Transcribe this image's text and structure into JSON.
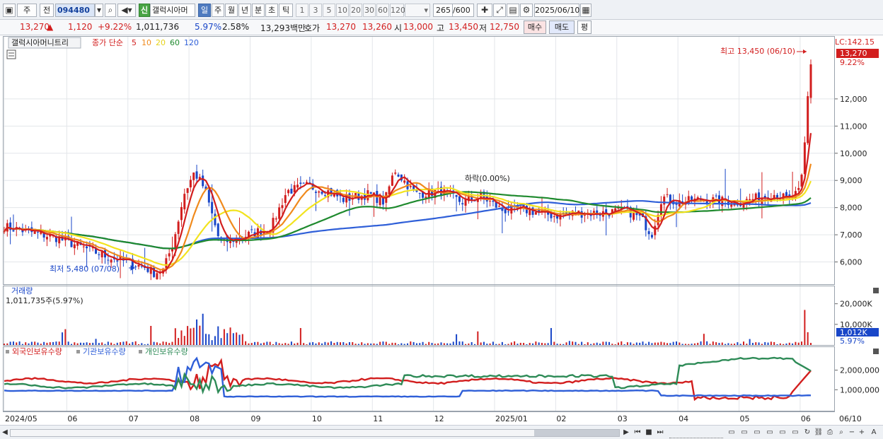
{
  "toolbar": {
    "market": "주",
    "prev": "전",
    "code": "094480",
    "new_badge": "신",
    "name": "갤럭시아머",
    "periods": [
      "일",
      "주",
      "월",
      "년",
      "분",
      "초",
      "틱"
    ],
    "active_period": "일",
    "intervals": [
      "1",
      "3",
      "5",
      "10",
      "20",
      "30",
      "60",
      "120"
    ],
    "count": "265",
    "count_max": "/600",
    "date": "2025/06/10"
  },
  "quote": {
    "price": "13,270",
    "arrow": "▲",
    "change": "1,120",
    "change_pct": "+9.22%",
    "volume": "1,011,736",
    "turnover_pct": "5.97%",
    "turnover2": "2.58%",
    "amount": "13,293백만",
    "bid_label": "호가",
    "ask": "13,270",
    "bid": "13,260",
    "open_label": "시",
    "open": "13,000",
    "high_label": "고",
    "high": "13,450",
    "low_label": "저",
    "low": "12,750",
    "buy_label": "매수",
    "sell_label": "매도",
    "eval_label": "평"
  },
  "legend": {
    "title": "갤럭시아머니트리",
    "ma_label": "종가 단순",
    "ma_periods": [
      "5",
      "10",
      "20",
      "60",
      "120"
    ]
  },
  "annotations": {
    "lc": "LC:142.15",
    "last_price": "13,270",
    "last_pct": "9.22%",
    "high_note": "최고 13,450 (06/10)",
    "low_note": "최저 5,480 (07/08)",
    "drop_note": "하락(0.00%)"
  },
  "volume_panel": {
    "title": "거래량",
    "value": "1,011,735주(5.97%)",
    "last_value": "1,012K",
    "last_pct": "5.97%"
  },
  "holding_panel": {
    "legend": [
      "외국인보유수량",
      "기관보유수량",
      "개인보유수량"
    ]
  },
  "colors": {
    "up": "#d21e1e",
    "down": "#1946c8",
    "ma5": "#d21e1e",
    "ma10": "#f08a1c",
    "ma20": "#f2e31e",
    "ma60": "#1f8a2e",
    "ma120": "#2f5fd8",
    "foreign": "#d21e1e",
    "institution": "#2f5fd8",
    "individual": "#2e8b57"
  },
  "chart_data": [
    {
      "type": "candlestick",
      "x": [
        "2024/05",
        "06",
        "07",
        "08",
        "09",
        "10",
        "11",
        "12",
        "2025/01",
        "02",
        "03",
        "04",
        "05",
        "06"
      ],
      "y_ticks": [
        "6,000",
        "7,000",
        "8,000",
        "9,000",
        "10,000",
        "11,000",
        "12,000"
      ],
      "ylim": [
        5000,
        14000
      ],
      "keypoints": [
        {
          "label": "2024/05",
          "close": 7300
        },
        {
          "label": "06",
          "close": 6200
        },
        {
          "label": "07/08",
          "close": 5600
        },
        {
          "label": "07 end",
          "close": 9300
        },
        {
          "label": "08",
          "close": 6900
        },
        {
          "label": "09",
          "close": 8800
        },
        {
          "label": "10",
          "close": 8300
        },
        {
          "label": "11",
          "close": 8800
        },
        {
          "label": "12",
          "close": 8400
        },
        {
          "label": "2025/01",
          "close": 7900
        },
        {
          "label": "02",
          "close": 7700
        },
        {
          "label": "03",
          "close": 7900
        },
        {
          "label": "04",
          "close": 7200
        },
        {
          "label": "05",
          "close": 8300
        },
        {
          "label": "06/10",
          "close": 13270
        }
      ],
      "high": 13450,
      "low": 5480
    },
    {
      "type": "bar",
      "title": "거래량",
      "y_ticks": [
        "10,000K",
        "20,000K"
      ]
    },
    {
      "type": "line",
      "y_ticks": [
        "1,000,000",
        "2,000,000"
      ],
      "series": [
        {
          "name": "외국인보유수량"
        },
        {
          "name": "기관보유수량"
        },
        {
          "name": "개인보유수량"
        }
      ]
    }
  ],
  "footer": {
    "time_label": "06/10",
    "controls": [
      "▶",
      "⏮",
      "■",
      "⏭"
    ],
    "zoom": [
      "−",
      "+",
      "A"
    ]
  }
}
